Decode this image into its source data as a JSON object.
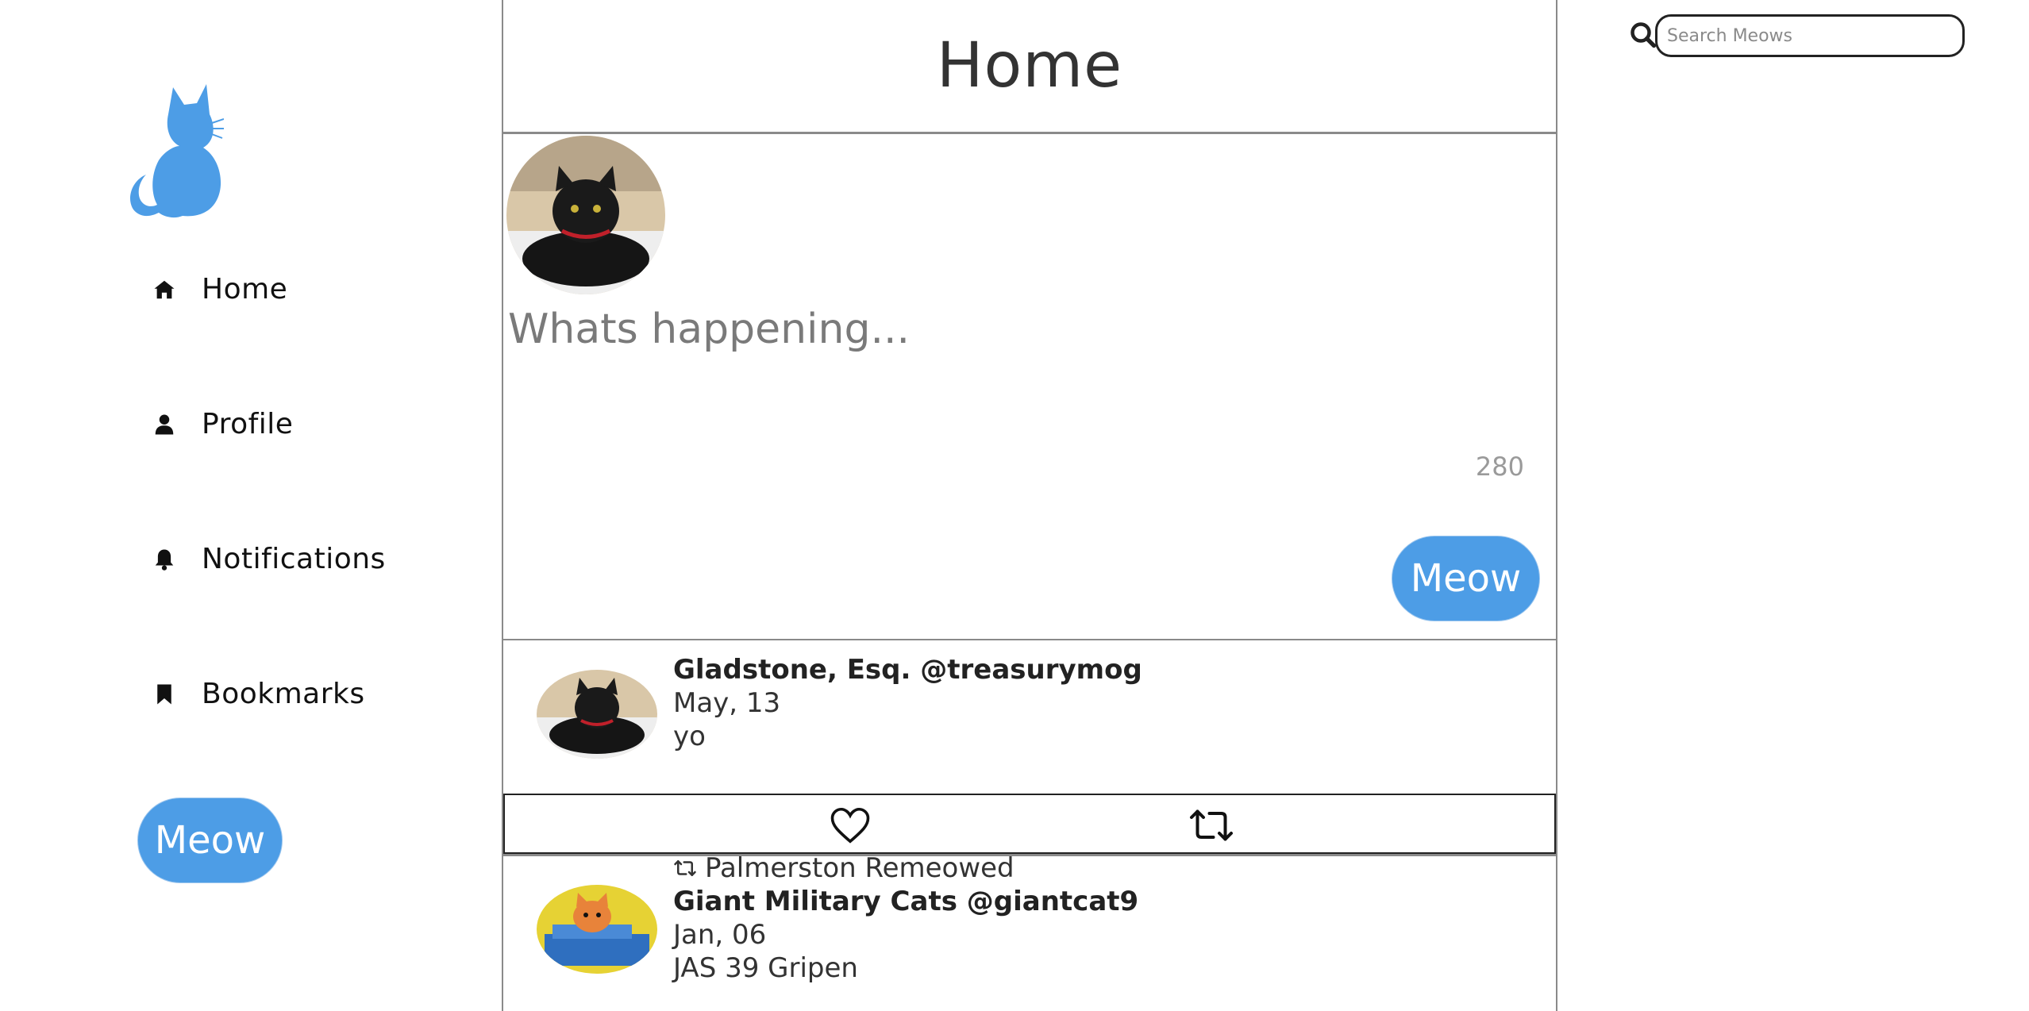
{
  "sidebar": {
    "logo": "cat-silhouette-logo",
    "items": [
      {
        "label": "Home",
        "icon": "home-icon"
      },
      {
        "label": "Profile",
        "icon": "user-icon"
      },
      {
        "label": "Notifications",
        "icon": "bell-icon"
      },
      {
        "label": "Bookmarks",
        "icon": "bookmark-icon"
      }
    ],
    "meow_button": "Meow"
  },
  "header": {
    "title": "Home"
  },
  "compose": {
    "placeholder": "Whats happening...",
    "char_count": "280",
    "meow_button": "Meow"
  },
  "feed": [
    {
      "author": "Gladstone, Esq. @treasurymog",
      "date": "May, 13",
      "body": "yo",
      "actions": [
        "heart-icon",
        "remeow-icon"
      ]
    },
    {
      "remeowed_by": "Palmerston Remeowed",
      "author": "Giant Military Cats @giantcat9",
      "date": "Jan, 06",
      "body": "JAS 39 Gripen"
    }
  ],
  "search": {
    "placeholder": "Search Meows"
  },
  "colors": {
    "accent": "#4d9de6",
    "border": "#8a8a8a"
  }
}
